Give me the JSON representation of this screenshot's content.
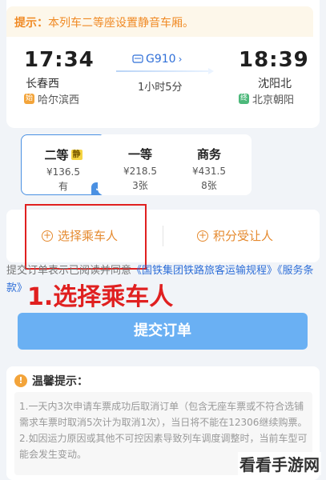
{
  "notice": {
    "label": "提示：",
    "text": "本列车二等座设置静音车厢。"
  },
  "trip": {
    "depart_time": "17:34",
    "depart_station": "长春西",
    "depart_via_tag": "始",
    "depart_via": "哈尔滨西",
    "arrive_time": "18:39",
    "arrive_station": "沈阳北",
    "arrive_via_tag": "终",
    "arrive_via": "北京朝阳",
    "train_no": "G910",
    "duration": "1小时5分"
  },
  "seats": [
    {
      "name": "二等",
      "badge": "静",
      "price": "¥136.5",
      "count": "有",
      "selected": true
    },
    {
      "name": "一等",
      "price": "¥218.5",
      "count": "3张"
    },
    {
      "name": "商务",
      "price": "¥431.5",
      "count": "8张"
    }
  ],
  "actions": {
    "select_passenger": "选择乘车人",
    "points_transfer": "积分受让人"
  },
  "agreement": {
    "prefix": "提交订单表示已阅读并同意",
    "link1": "《国铁集团铁路旅客运输规程》",
    "link2": "《服务条款》"
  },
  "annotation": "1.选择乘车人",
  "submit": "提交订单",
  "tips": {
    "title": "温馨提示：",
    "line1": "1.一天内3次申请车票成功后取消订单（包含无座车票或不符合选铺需求车票时取消5次计为取消1次），当日将不能在12306继续购票。",
    "line2": "2.如因运力原因或其他不可控因素导致列车调度调整时，当前车型可能会发生变动。"
  },
  "watermark": "看看手游网",
  "colors": {
    "accent": "#4a90e2",
    "orange": "#e58a2f",
    "annotation_red": "#e02020"
  }
}
